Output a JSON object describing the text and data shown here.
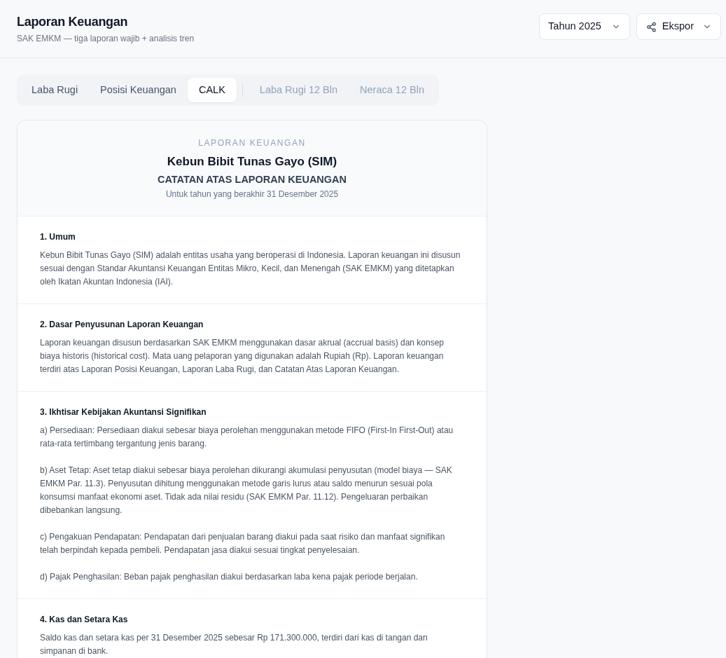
{
  "header": {
    "title": "Laporan Keuangan",
    "subtitle": "SAK EMKM — tiga laporan wajib + analisis tren"
  },
  "controls": {
    "year_select": {
      "value": "Tahun 2025"
    },
    "export_button": {
      "label": "Ekspor"
    }
  },
  "tabs": [
    {
      "label": "Laba Rugi",
      "kind": "report",
      "selected": false
    },
    {
      "label": "Posisi Keuangan",
      "kind": "report",
      "selected": false
    },
    {
      "label": "CALK",
      "kind": "report",
      "selected": true
    },
    {
      "label": "Laba Rugi 12 Bln",
      "kind": "trend",
      "selected": false
    },
    {
      "label": "Neraca 12 Bln",
      "kind": "trend",
      "selected": false
    }
  ],
  "report": {
    "eyebrow": "LAPORAN KEUANGAN",
    "company": "Kebun Bibit Tunas Gayo (SIM)",
    "title": "CATATAN ATAS LAPORAN KEUANGAN",
    "period": "Untuk tahun yang berakhir 31 Desember 2025",
    "sections": [
      {
        "heading": "1. Umum",
        "paragraphs": [
          "Kebun Bibit Tunas Gayo (SIM) adalah entitas usaha yang beroperasi di Indonesia. Laporan keuangan ini disusun sesuai dengan Standar Akuntansi Keuangan Entitas Mikro, Kecil, dan Menengah (SAK EMKM) yang ditetapkan oleh Ikatan Akuntan Indonesia (IAI)."
        ]
      },
      {
        "heading": "2. Dasar Penyusunan Laporan Keuangan",
        "paragraphs": [
          "Laporan keuangan disusun berdasarkan SAK EMKM menggunakan dasar akrual (accrual basis) dan konsep biaya historis (historical cost). Mata uang pelaporan yang digunakan adalah Rupiah (Rp). Laporan keuangan terdiri atas Laporan Posisi Keuangan, Laporan Laba Rugi, dan Catatan Atas Laporan Keuangan."
        ]
      },
      {
        "heading": "3. Ikhtisar Kebijakan Akuntansi Signifikan",
        "paragraphs": [
          "a) Persediaan: Persediaan diakui sebesar biaya perolehan menggunakan metode FIFO (First-In First-Out) atau rata-rata tertimbang tergantung jenis barang.",
          "b) Aset Tetap: Aset tetap diakui sebesar biaya perolehan dikurangi akumulasi penyusutan (model biaya — SAK EMKM Par. 11.3). Penyusutan dihitung menggunakan metode garis lurus atau saldo menurun sesuai pola konsumsi manfaat ekonomi aset. Tidak ada nilai residu (SAK EMKM Par. 11.12). Pengeluaran perbaikan dibebankan langsung.",
          "c) Pengakuan Pendapatan: Pendapatan dari penjualan barang diakui pada saat risiko dan manfaat signifikan telah berpindah kepada pembeli. Pendapatan jasa diakui sesuai tingkat penyelesaian.",
          "d) Pajak Penghasilan: Beban pajak penghasilan diakui berdasarkan laba kena pajak periode berjalan."
        ]
      },
      {
        "heading": "4. Kas dan Setara Kas",
        "paragraphs": [
          "Saldo kas dan setara kas per 31 Desember 2025 sebesar Rp 171.300.000, terdiri dari kas di tangan dan simpanan di bank."
        ]
      }
    ]
  }
}
